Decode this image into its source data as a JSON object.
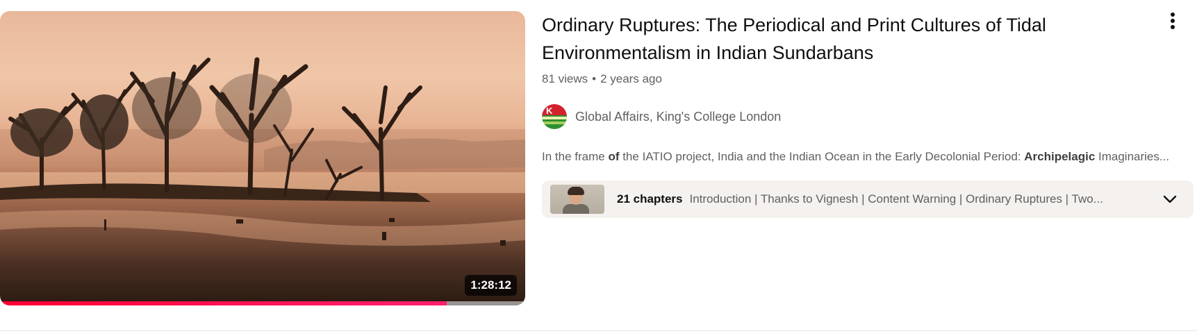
{
  "video": {
    "title": "Ordinary Ruptures: The Periodical and Print Cultures of Tidal Environmentalism in Indian Sundarbans",
    "views": "81 views",
    "separator": "•",
    "age": "2 years ago",
    "duration": "1:28:12",
    "watch_progress_fraction": 0.85,
    "thumbnail_icon": "mangrove-landscape-thumbnail"
  },
  "channel": {
    "name": "Global Affairs, King's College London",
    "avatar_letter": "K"
  },
  "description": {
    "part1": "In the frame ",
    "part2": "of",
    "part3": " the IATIO project, India and the Indian Ocean in the Early Decolonial Period: ",
    "part4": "Archipelagic",
    "part5": " Imaginaries..."
  },
  "chapters": {
    "count_label": "21 chapters",
    "list": "Introduction | Thanks to Vignesh | Content Warning | Ordinary Ruptures | Two..."
  },
  "icons": {
    "menu": "more-vert-icon",
    "expand": "chevron-down-icon"
  },
  "colors": {
    "progress": "#ff0033",
    "text_secondary": "#606060",
    "chapters_bg": "#f4f1ee"
  }
}
